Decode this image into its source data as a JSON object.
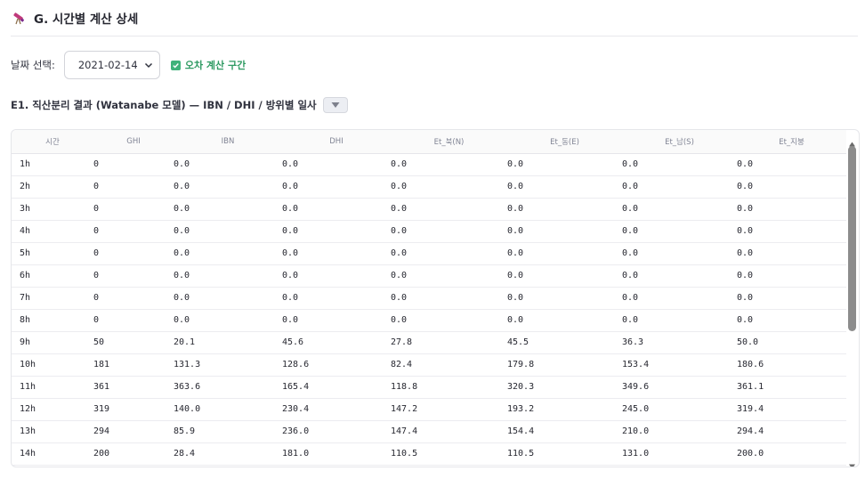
{
  "header": {
    "title": "G. 시간별 계산 상세",
    "icon": "telescope-icon"
  },
  "controls": {
    "date_label": "날짜 선택:",
    "date_value": "2021-02-14",
    "checkbox_label": "오차 계산 구간",
    "checkbox_checked": true
  },
  "section": {
    "title": "E1. 직산분리 결과 (Watanabe 모델) — IBN / DHI / 방위별 일사"
  },
  "table": {
    "columns": [
      "시간",
      "GHI",
      "IBN",
      "DHI",
      "Et_북(N)",
      "Et_동(E)",
      "Et_남(S)",
      "Et_지붕"
    ],
    "rows": [
      [
        "1h",
        "0",
        "0.0",
        "0.0",
        "0.0",
        "0.0",
        "0.0",
        "0.0"
      ],
      [
        "2h",
        "0",
        "0.0",
        "0.0",
        "0.0",
        "0.0",
        "0.0",
        "0.0"
      ],
      [
        "3h",
        "0",
        "0.0",
        "0.0",
        "0.0",
        "0.0",
        "0.0",
        "0.0"
      ],
      [
        "4h",
        "0",
        "0.0",
        "0.0",
        "0.0",
        "0.0",
        "0.0",
        "0.0"
      ],
      [
        "5h",
        "0",
        "0.0",
        "0.0",
        "0.0",
        "0.0",
        "0.0",
        "0.0"
      ],
      [
        "6h",
        "0",
        "0.0",
        "0.0",
        "0.0",
        "0.0",
        "0.0",
        "0.0"
      ],
      [
        "7h",
        "0",
        "0.0",
        "0.0",
        "0.0",
        "0.0",
        "0.0",
        "0.0"
      ],
      [
        "8h",
        "0",
        "0.0",
        "0.0",
        "0.0",
        "0.0",
        "0.0",
        "0.0"
      ],
      [
        "9h",
        "50",
        "20.1",
        "45.6",
        "27.8",
        "45.5",
        "36.3",
        "50.0"
      ],
      [
        "10h",
        "181",
        "131.3",
        "128.6",
        "82.4",
        "179.8",
        "153.4",
        "180.6"
      ],
      [
        "11h",
        "361",
        "363.6",
        "165.4",
        "118.8",
        "320.3",
        "349.6",
        "361.1"
      ],
      [
        "12h",
        "319",
        "140.0",
        "230.4",
        "147.2",
        "193.2",
        "245.0",
        "319.4"
      ],
      [
        "13h",
        "294",
        "85.9",
        "236.0",
        "147.4",
        "154.4",
        "210.0",
        "294.4"
      ],
      [
        "14h",
        "200",
        "28.4",
        "181.0",
        "110.5",
        "110.5",
        "131.0",
        "200.0"
      ]
    ]
  },
  "colors": {
    "checkbox": "#3fb27a",
    "checkbox_text": "#2e9a62",
    "text": "#262730",
    "header_text": "#808494"
  }
}
